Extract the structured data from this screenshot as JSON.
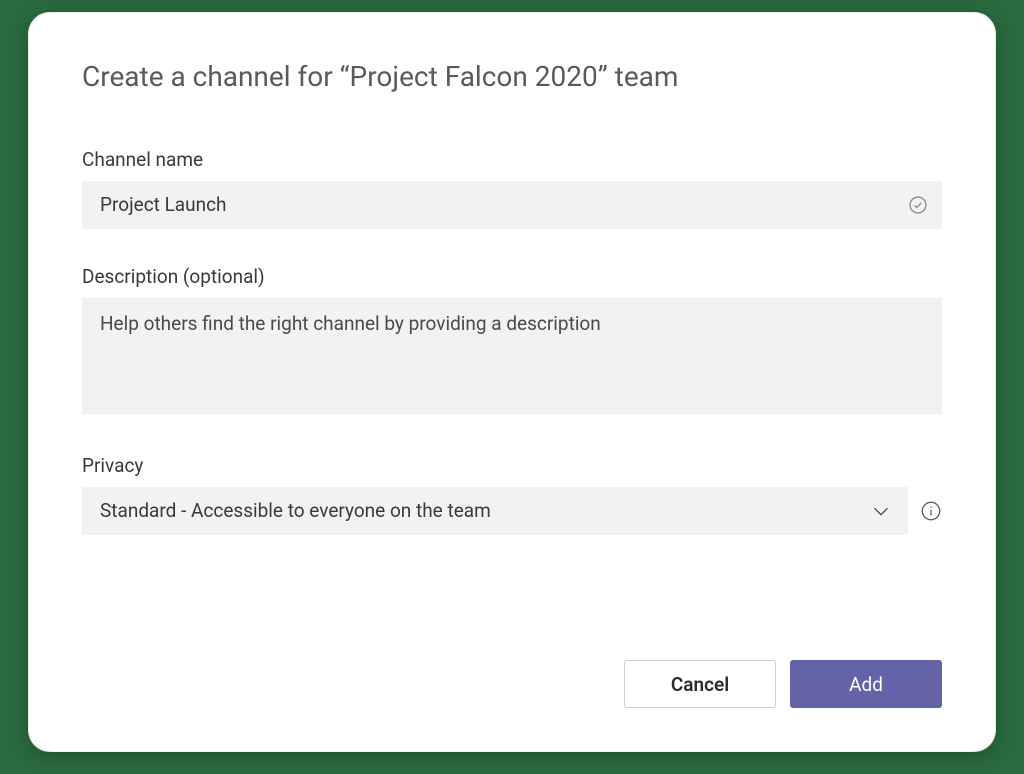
{
  "dialog": {
    "title": "Create a channel for “Project Falcon 2020” team",
    "channel_name": {
      "label": "Channel name",
      "value": "Project Launch"
    },
    "description": {
      "label": "Description (optional)",
      "placeholder": "Help others find the right channel by providing a description",
      "value": ""
    },
    "privacy": {
      "label": "Privacy",
      "selected": "Standard - Accessible to everyone on the team"
    },
    "buttons": {
      "cancel": "Cancel",
      "add": "Add"
    }
  }
}
